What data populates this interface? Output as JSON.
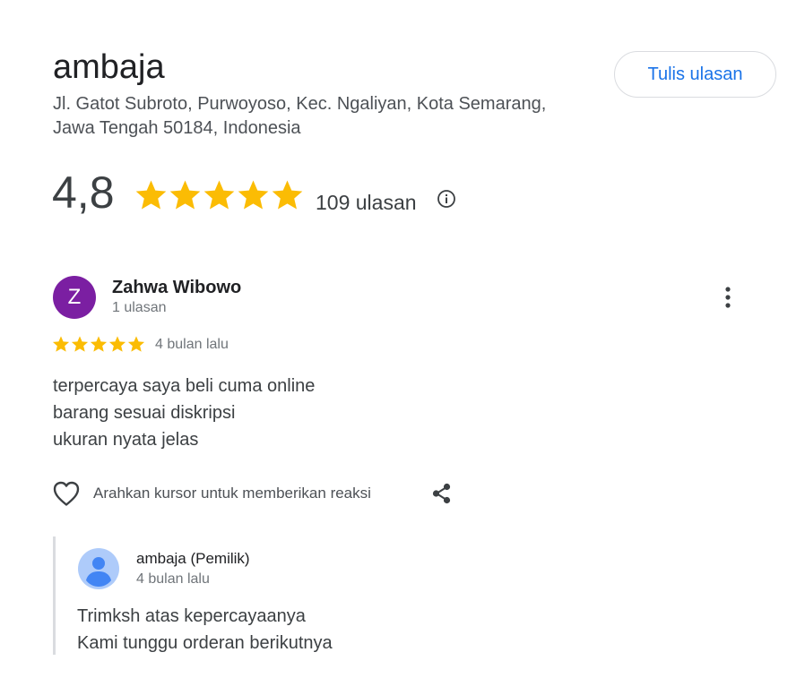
{
  "business": {
    "name": "ambaja",
    "address_line1": "Jl. Gatot Subroto, Purwoyoso, Kec. Ngaliyan, Kota Semarang,",
    "address_line2": "Jawa Tengah 50184, Indonesia",
    "write_review_label": "Tulis ulasan"
  },
  "rating": {
    "value": "4,8",
    "stars": 5,
    "count_label": "109 ulasan"
  },
  "review": {
    "avatar_letter": "Z",
    "avatar_color": "#7b1fa2",
    "author": "Zahwa Wibowo",
    "author_meta": "1 ulasan",
    "stars": 5,
    "date": "4 bulan lalu",
    "lines": [
      "terpercaya saya beli cuma online",
      "barang sesuai diskripsi",
      "ukuran nyata jelas"
    ],
    "reaction_prompt": "Arahkan kursor untuk memberikan reaksi"
  },
  "owner_reply": {
    "author": "ambaja (Pemilik)",
    "date": "4 bulan lalu",
    "lines": [
      "Trimksh atas kepercayaanya",
      "Kami tunggu orderan berikutnya"
    ]
  },
  "colors": {
    "star": "#fbbc04",
    "accent": "#1a73e8"
  },
  "icons": {
    "info": "info-icon",
    "more": "more-vert-icon",
    "heart": "heart-outline-icon",
    "share": "share-icon",
    "owner_avatar": "person-avatar-icon"
  }
}
